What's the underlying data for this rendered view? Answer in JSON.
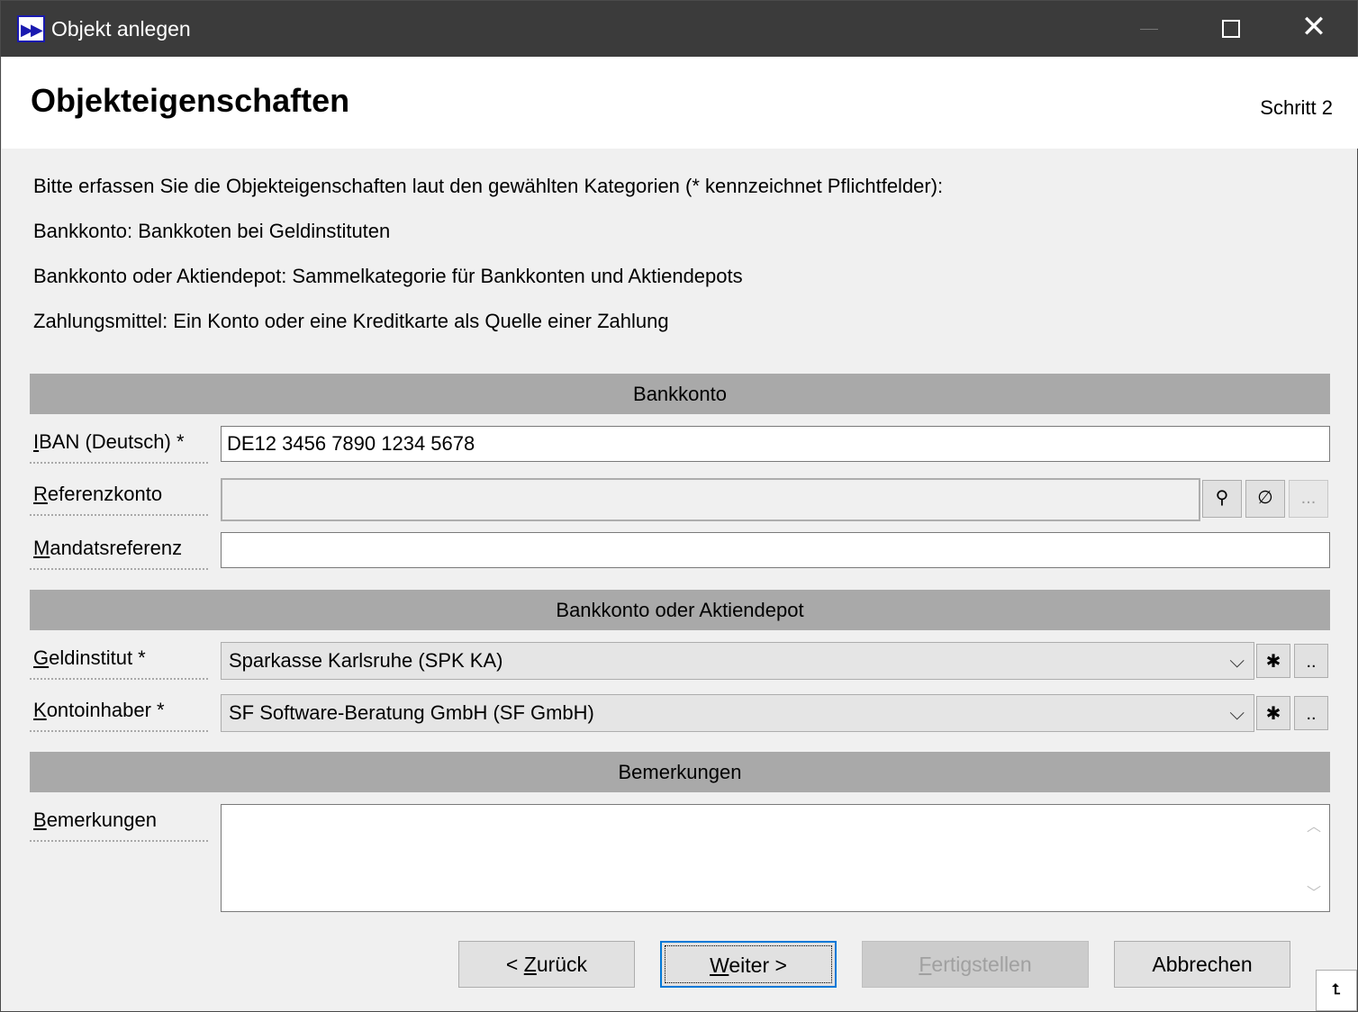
{
  "window": {
    "title": "Objekt anlegen"
  },
  "header": {
    "title": "Objekteigenschaften",
    "step": "Schritt 2"
  },
  "description": {
    "intro": "Bitte erfassen Sie die Objekteigenschaften laut den gewählten Kategorien (* kennzeichnet Pflichtfelder):",
    "category_1": "Bankkonto: Bankkoten bei Geldinstituten",
    "category_2": "Bankkonto oder Aktiendepot: Sammelkategorie für Bankkonten und Aktiendepots",
    "category_3": "Zahlungsmittel: Ein Konto oder eine Kreditkarte als Quelle einer Zahlung"
  },
  "sections": {
    "bankkonto": "Bankkonto",
    "depot": "Bankkonto oder Aktiendepot",
    "remarks": "Bemerkungen"
  },
  "fields": {
    "iban": {
      "label_u": "I",
      "label_rest": "BAN (Deutsch) *",
      "value": "DE12 3456 7890 1234 5678"
    },
    "reference": {
      "label_u": "R",
      "label_rest": "eferenzkonto",
      "value": ""
    },
    "mandate": {
      "label_u": "M",
      "label_rest": "andatsreferenz",
      "value": ""
    },
    "bank": {
      "label_u": "G",
      "label_rest": "eldinstitut *",
      "value": "Sparkasse Karlsruhe (SPK KA)"
    },
    "owner": {
      "label_u": "K",
      "label_rest": "ontoinhaber *",
      "value": "SF Software-Beratung GmbH (SF GmbH)"
    },
    "remarks": {
      "label_u": "B",
      "label_rest": "emerkungen",
      "value": ""
    }
  },
  "icons": {
    "pin": "⚲",
    "clear": "∅",
    "ellipsis": "...",
    "star": "✱",
    "dots": "..",
    "chevron": "⌵",
    "grip": "⮤"
  },
  "buttons": {
    "back_prefix": "< ",
    "back_u": "Z",
    "back_rest": "urück",
    "next_u": "W",
    "next_rest": "eiter >",
    "finish_u": "F",
    "finish_rest": "ertigstellen",
    "cancel": "Abbrechen"
  }
}
